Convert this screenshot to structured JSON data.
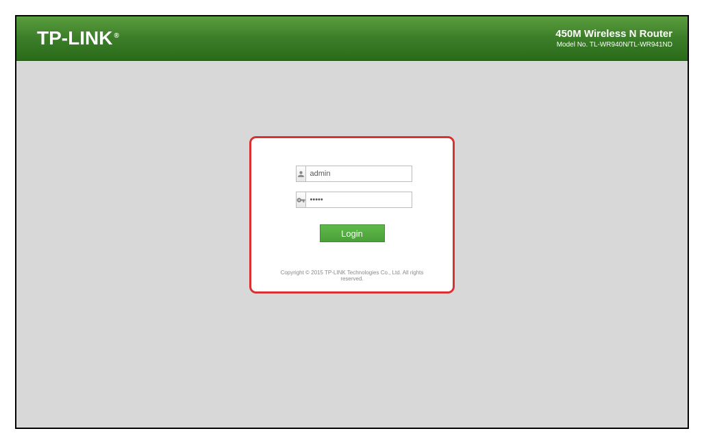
{
  "header": {
    "logo_text": "TP-LINK",
    "product_title": "450M Wireless N Router",
    "model_no": "Model No. TL-WR940N/TL-WR941ND"
  },
  "login": {
    "username_value": "admin",
    "password_value": "•••••",
    "button_label": "Login"
  },
  "footer": {
    "copyright": "Copyright © 2015 TP-LINK Technologies Co., Ltd. All rights reserved."
  }
}
